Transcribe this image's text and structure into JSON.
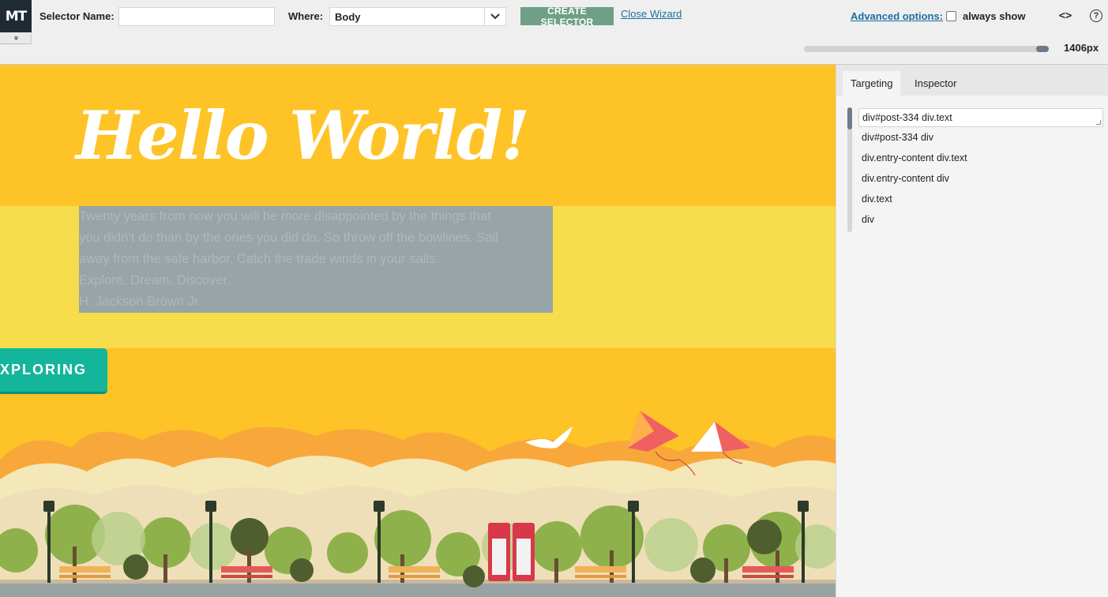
{
  "toolbar": {
    "logo": "MT",
    "expand_glyph": "»",
    "selector_name_label": "Selector Name:",
    "selector_name_value": "",
    "where_label": "Where:",
    "where_value": "Body",
    "create_button": "CREATE SELECTOR",
    "close_wizard": "Close Wizard",
    "advanced_options": "Advanced options:",
    "always_show": "always show",
    "always_show_checked": false,
    "code_icon": "<>",
    "help_icon": "?",
    "viewport_width_label": "1406px",
    "viewport_slider_fraction": 1.0
  },
  "preview": {
    "heading": "Hello World!",
    "quote_lines": [
      "Twenty years from now you will be more disappointed by the things that",
      "you didn’t do than by the ones you did do. So throw off the bowlines. Sail",
      "away from the safe harbor. Catch the trade winds in your sails.",
      "Explore. Dream. Discover.",
      "H. Jackson Brown Jr."
    ],
    "button": "XPLORING"
  },
  "panel": {
    "tabs": [
      "Targeting",
      "Inspector"
    ],
    "active_tab": "Targeting",
    "selector_input": "div#post-334 div.text",
    "suggestions": [
      "div#post-334 div",
      "div.entry-content div.text",
      "div.entry-content div",
      "div.text",
      "div"
    ]
  },
  "colors": {
    "preview_bg": "#fec327",
    "band_bg": "#f7dc4b",
    "highlight": "#98a4a6",
    "button_teal": "#13b69a",
    "create_btn": "#6f9f87",
    "logo_bg": "#1f2a33",
    "link": "#1a6fa1"
  }
}
